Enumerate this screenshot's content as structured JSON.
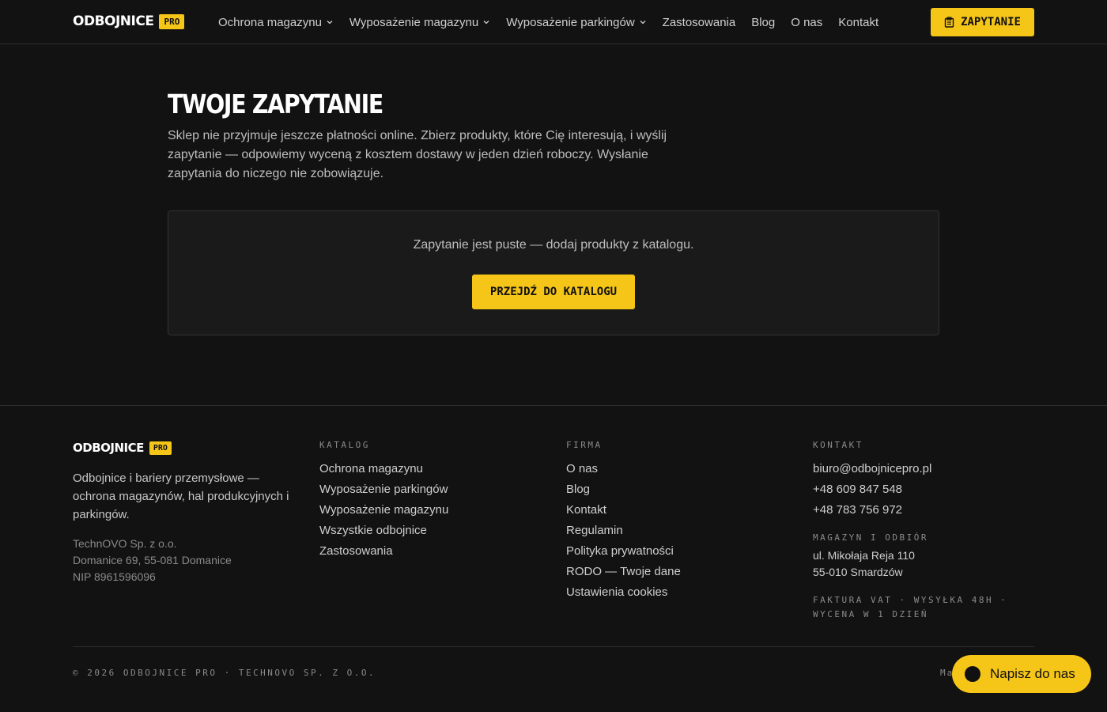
{
  "brand": {
    "name": "ODBOJNICE",
    "badge": "PRO"
  },
  "nav": {
    "items": [
      {
        "label": "Ochrona magazynu",
        "has_dropdown": true
      },
      {
        "label": "Wyposażenie magazynu",
        "has_dropdown": true
      },
      {
        "label": "Wyposażenie parkingów",
        "has_dropdown": true
      },
      {
        "label": "Zastosowania",
        "has_dropdown": false
      },
      {
        "label": "Blog",
        "has_dropdown": false
      },
      {
        "label": "O nas",
        "has_dropdown": false
      },
      {
        "label": "Kontakt",
        "has_dropdown": false
      }
    ],
    "cta_label": "ZAPYTANIE",
    "cta_icon": "clipboard-icon"
  },
  "main": {
    "title": "TWOJE ZAPYTANIE",
    "intro": "Sklep nie przyjmuje jeszcze płatności online. Zbierz produkty, które Cię interesują, i wyślij zapytanie — odpowiemy wyceną z kosztem dostawy w jeden dzień roboczy. Wysłanie zapytania do niczego nie zobowiązuje.",
    "empty_message": "Zapytanie jest puste — dodaj produkty z katalogu.",
    "catalog_button": "PRZEJDŹ DO KATALOGU"
  },
  "footer": {
    "description": "Odbojnice i bariery przemysłowe — ochrona magazynów, hal produkcyjnych i parkingów.",
    "company": {
      "name": "TechnOVO Sp. z o.o.",
      "address": "Domanice 69, 55-081 Domanice",
      "nip": "NIP 8961596096"
    },
    "katalog": {
      "heading": "KATALOG",
      "links": [
        "Ochrona magazynu",
        "Wyposażenie parkingów",
        "Wyposażenie magazynu",
        "Wszystkie odbojnice",
        "Zastosowania"
      ]
    },
    "firma": {
      "heading": "FIRMA",
      "links": [
        "O nas",
        "Blog",
        "Kontakt",
        "Regulamin",
        "Polityka prywatności",
        "RODO — Twoje dane",
        "Ustawienia cookies"
      ]
    },
    "kontakt": {
      "heading": "KONTAKT",
      "links": [
        "biuro@odbojnicepro.pl",
        "+48 609 847 548",
        "+48 783 756 972"
      ],
      "warehouse_heading": "MAGAZYN I ODBIÓR",
      "warehouse_line1": "ul. Mikołaja Reja 110",
      "warehouse_line2": "55-010 Smardzów",
      "tagline": "FAKTURA VAT · WYSYŁKA 48H · WYCENA W 1 DZIEŃ"
    },
    "copyright": "© 2026 ODBOJNICE PRO · TECHNOVO SP. Z O.O.",
    "made_text": "Ma"
  },
  "chat": {
    "label": "Napisz do nas"
  },
  "colors": {
    "accent": "#f5c518",
    "background": "#121212"
  }
}
